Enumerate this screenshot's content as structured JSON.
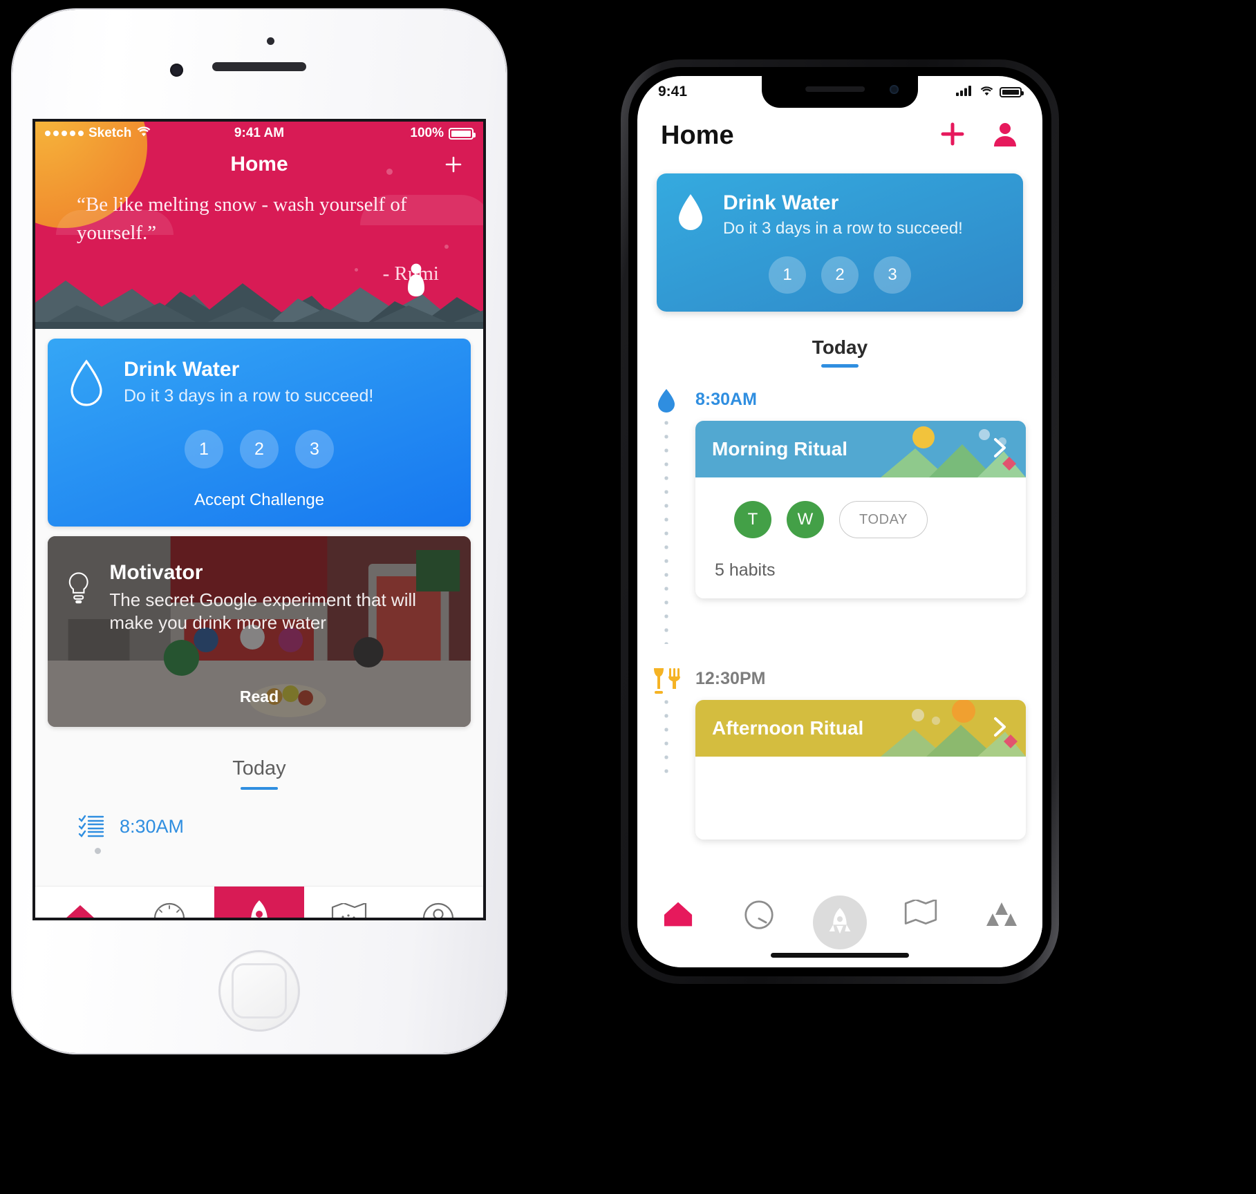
{
  "colors": {
    "brand_pink": "#d81b55",
    "water_blue": "#1677f0",
    "teal": "#52a8d1",
    "yellow": "#d4bd3f",
    "green": "#43a047",
    "accent_blue": "#2f8ee0",
    "sun_orange": "#f08c2e"
  },
  "phone_left": {
    "status_bar": {
      "signal_icon": "signal-dots-icon",
      "carrier": "Sketch",
      "wifi_icon": "wifi-icon",
      "time": "9:41 AM",
      "battery_percent": "100%",
      "battery_icon": "battery-full-icon"
    },
    "navbar": {
      "title": "Home",
      "add_icon": "plus-icon"
    },
    "hero": {
      "quote": "“Be like melting snow - wash yourself of yourself.”",
      "author": "- Rumi",
      "sun_icon": "sun-icon",
      "mountains_icon": "mountains-icon",
      "person_icon": "person-silhouette-icon"
    },
    "water_card": {
      "icon": "water-drop-icon",
      "title": "Drink Water",
      "subtitle": "Do it 3 days in a row to succeed!",
      "days": [
        "1",
        "2",
        "3"
      ],
      "action_label": "Accept Challenge"
    },
    "motivator_card": {
      "icon": "lightbulb-icon",
      "title": "Motivator",
      "subtitle": "The secret Google experiment that will make you drink more water",
      "action_label": "Read"
    },
    "today": {
      "label": "Today"
    },
    "timeline": {
      "icon": "checklist-icon",
      "time": "8:30AM"
    },
    "tabbar": {
      "items": [
        {
          "icon": "home-icon",
          "active": true
        },
        {
          "icon": "speedometer-icon",
          "active": false
        },
        {
          "icon": "rocket-icon",
          "active": true
        },
        {
          "icon": "map-icon",
          "active": false
        },
        {
          "icon": "profile-icon",
          "active": false
        }
      ]
    }
  },
  "phone_right": {
    "status_bar": {
      "time": "9:41",
      "cellular_icon": "cellular-bars-icon",
      "wifi_icon": "wifi-icon",
      "battery_icon": "battery-full-icon"
    },
    "navbar": {
      "title": "Home",
      "add_icon": "plus-icon",
      "profile_icon": "person-icon"
    },
    "water_card": {
      "icon": "water-drop-icon",
      "title": "Drink Water",
      "subtitle": "Do it 3 days in a row to succeed!",
      "days": [
        "1",
        "2",
        "3"
      ]
    },
    "today": {
      "label": "Today"
    },
    "timeline": [
      {
        "icon": "water-drop-icon",
        "time": "8:30AM",
        "ritual_title": "Morning Ritual",
        "ritual_color": "teal",
        "chevron_icon": "chevron-right-icon",
        "days": [
          "T",
          "W"
        ],
        "today_label": "TODAY",
        "habits_count": "5 habits"
      },
      {
        "icon": "dining-icon",
        "time": "12:30PM",
        "ritual_title": "Afternoon Ritual",
        "ritual_color": "yellow",
        "chevron_icon": "chevron-right-icon"
      }
    ],
    "tabbar": {
      "items": [
        {
          "icon": "home-icon",
          "active": true
        },
        {
          "icon": "speedometer-icon",
          "active": false
        },
        {
          "icon": "rocket-icon",
          "active": true
        },
        {
          "icon": "map-icon",
          "active": false
        },
        {
          "icon": "triangles-icon",
          "active": false
        }
      ]
    }
  }
}
